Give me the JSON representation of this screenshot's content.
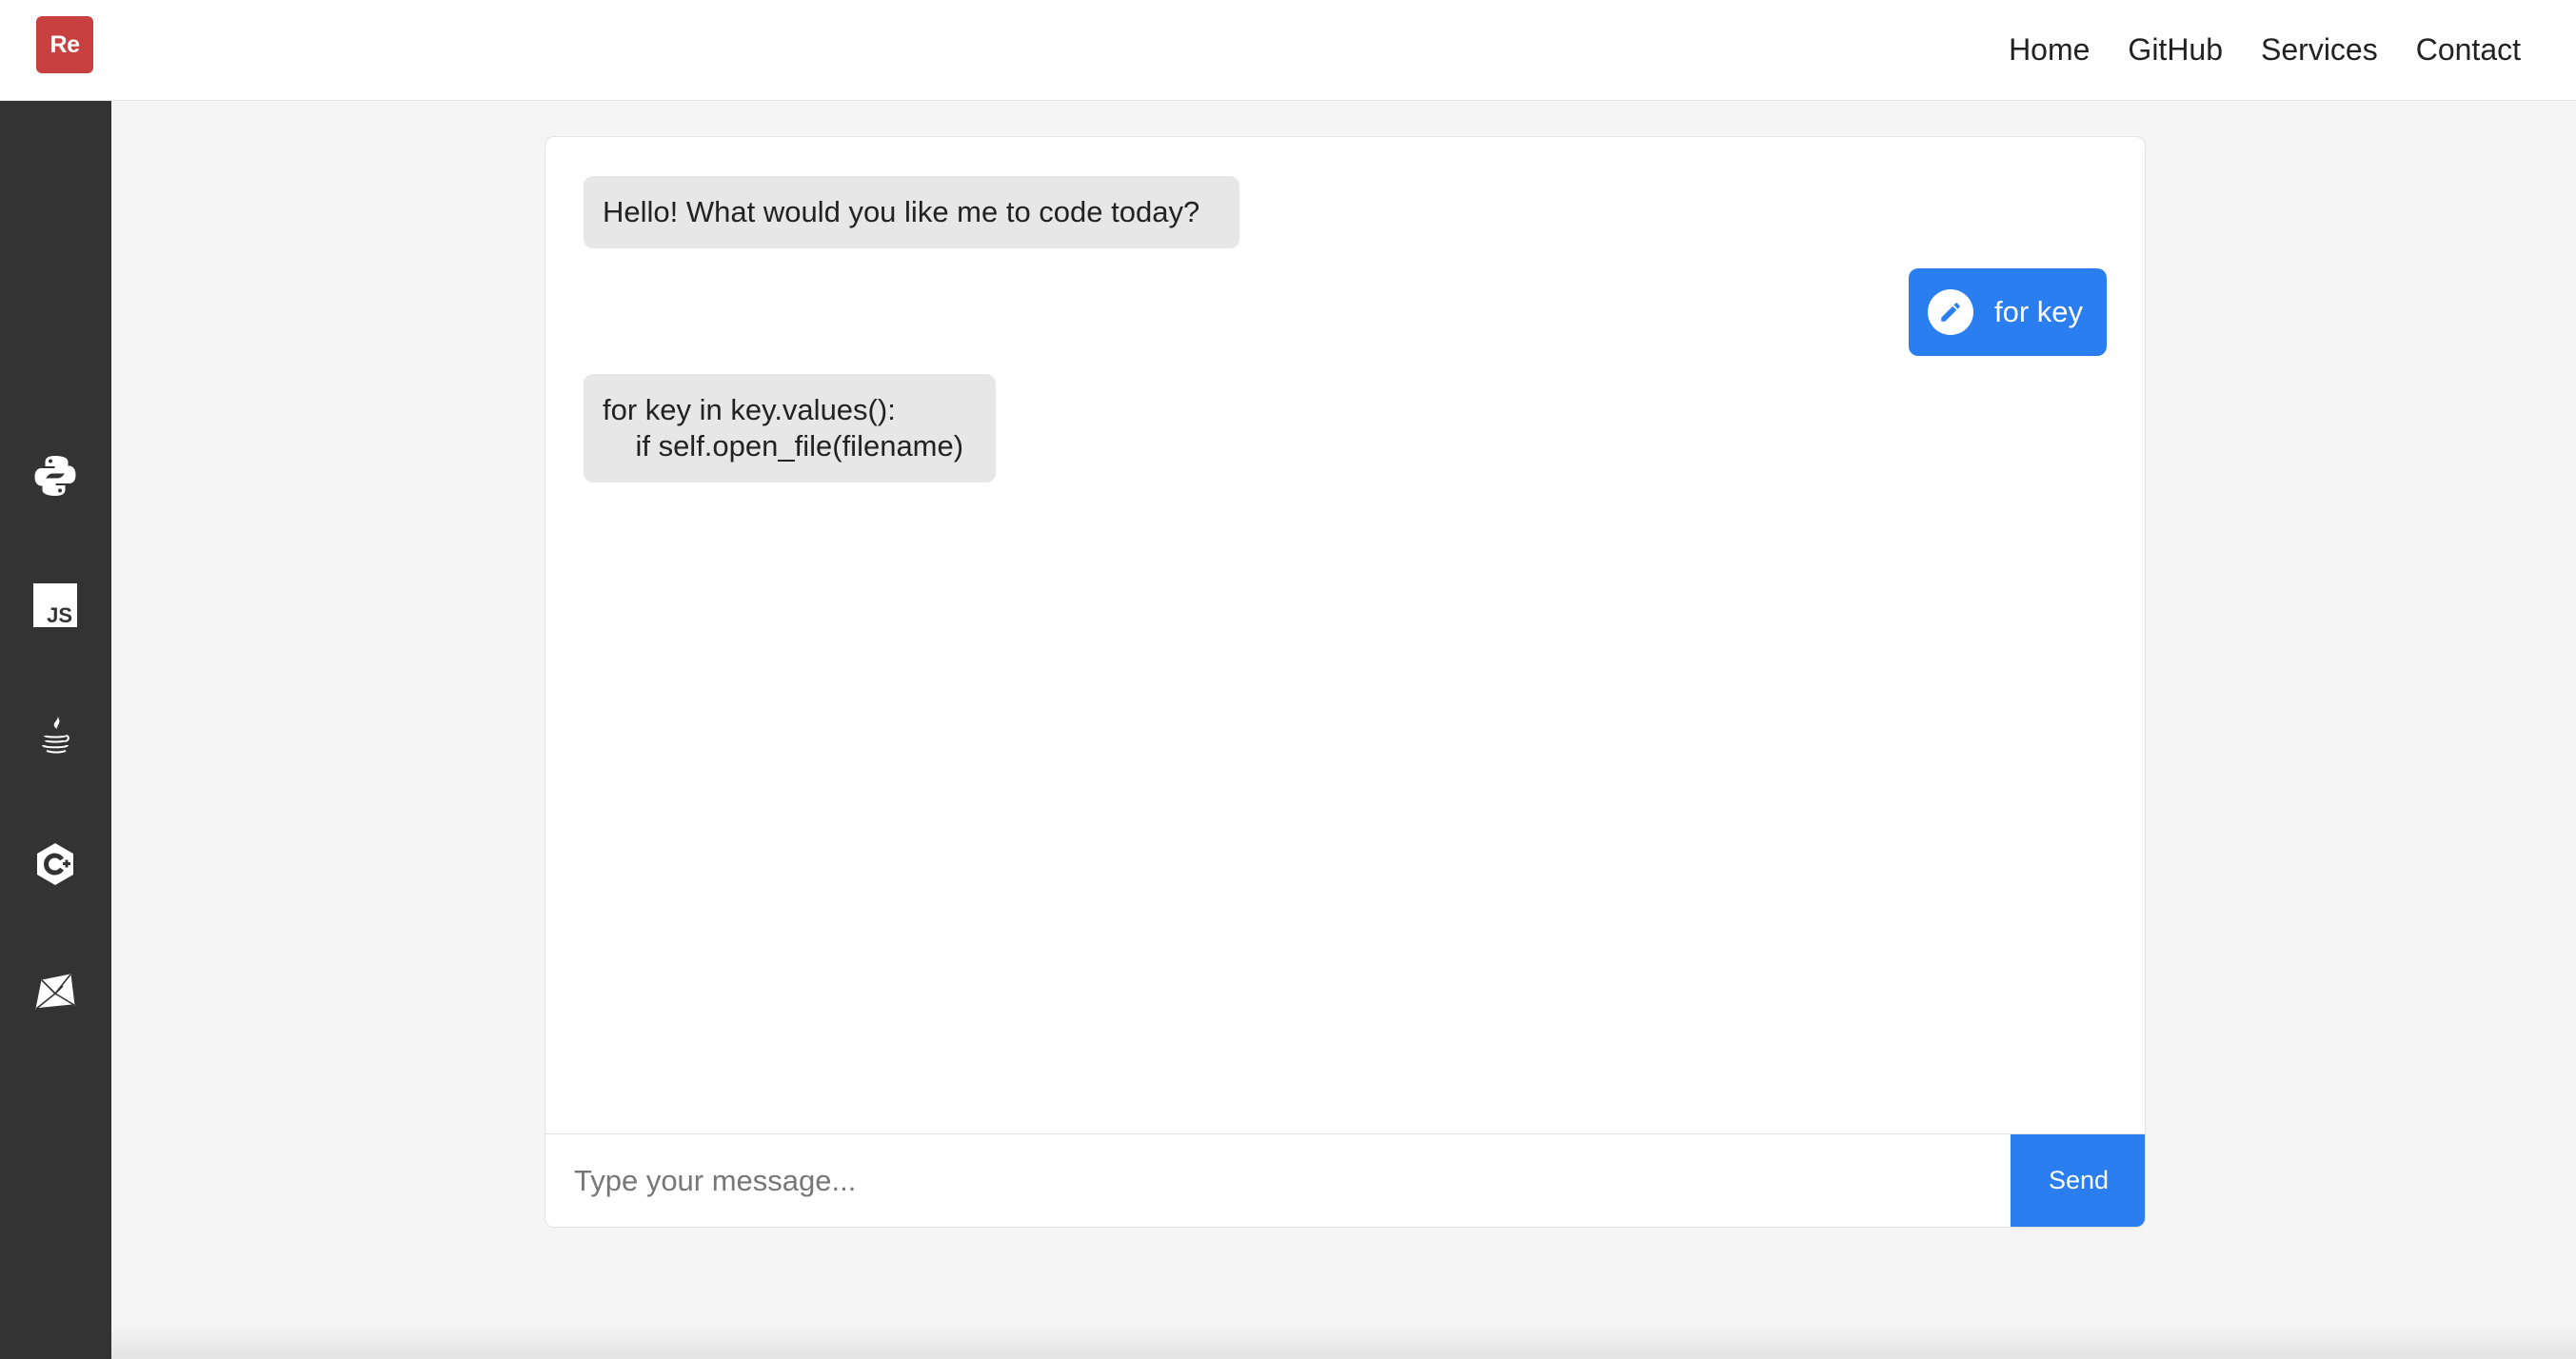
{
  "header": {
    "logo_text": "Re",
    "logo_color": "#c94040",
    "nav": [
      {
        "label": "Home"
      },
      {
        "label": "GitHub"
      },
      {
        "label": "Services"
      },
      {
        "label": "Contact"
      }
    ]
  },
  "sidebar": {
    "items": [
      {
        "icon": "python-icon"
      },
      {
        "icon": "javascript-icon"
      },
      {
        "icon": "java-icon"
      },
      {
        "icon": "cplusplus-icon"
      },
      {
        "icon": "ruby-icon"
      }
    ]
  },
  "chat": {
    "messages": [
      {
        "role": "bot",
        "text": "Hello! What would you like me to code today?"
      },
      {
        "role": "user",
        "icon": "pencil-icon",
        "text": "for key"
      },
      {
        "role": "bot",
        "text": "for key in key.values():\n    if self.open_file(filename)"
      }
    ],
    "input_placeholder": "Type your message...",
    "send_label": "Send",
    "accent_color": "#2a7ef0"
  }
}
